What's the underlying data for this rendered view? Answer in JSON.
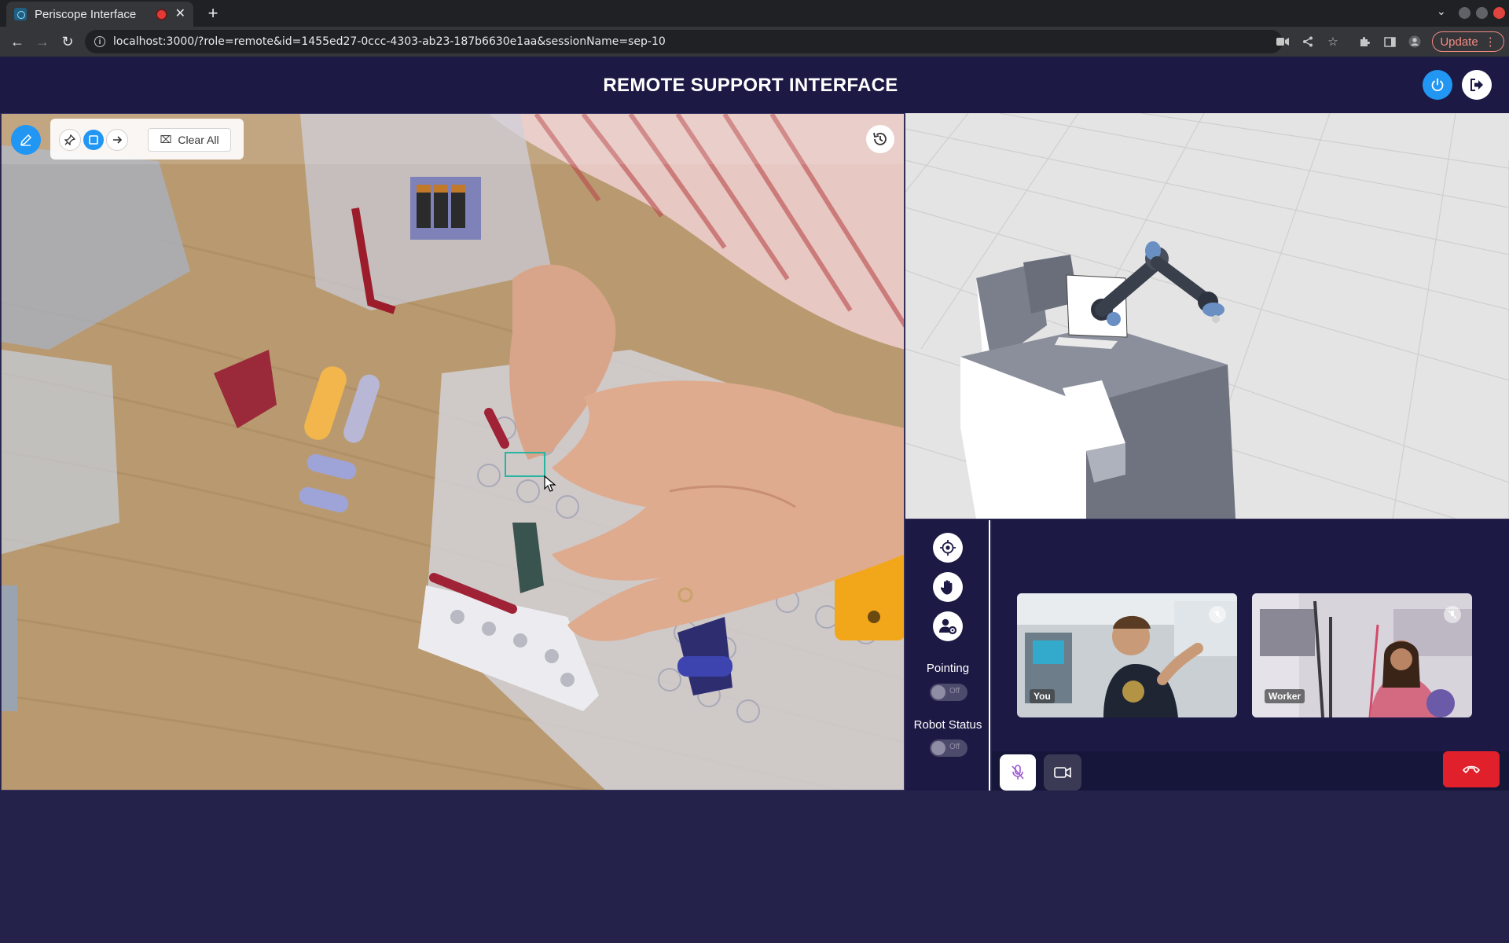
{
  "browser": {
    "tab_title": "Periscope Interface",
    "tab_close": "✕",
    "new_tab": "+",
    "url": "localhost:3000/?role=remote&id=1455ed27-0ccc-4303-ab23-187b6630e1aa&sessionName=sep-10",
    "update_label": "Update",
    "update_menu": "⋮",
    "recording": true
  },
  "app": {
    "title": "REMOTE SUPPORT INTERFACE"
  },
  "annotation_toolbar": {
    "tools": [
      "pin",
      "rectangle",
      "arrow"
    ],
    "active_tool": "rectangle",
    "clear_label": "Clear All",
    "selected_region": true
  },
  "controls": {
    "pointing_label": "Pointing",
    "pointing_state": "Off",
    "robot_status_label": "Robot Status",
    "robot_status_state": "Off"
  },
  "call": {
    "participants": [
      {
        "name": "You",
        "muted": true
      },
      {
        "name": "Worker",
        "muted": true
      }
    ],
    "mic_muted": true
  },
  "colors": {
    "header_bg": "#1c1a45",
    "page_bg": "#24224a",
    "accent": "#2196f3",
    "hangup": "#e0202b",
    "selection": "#26b5a0"
  }
}
